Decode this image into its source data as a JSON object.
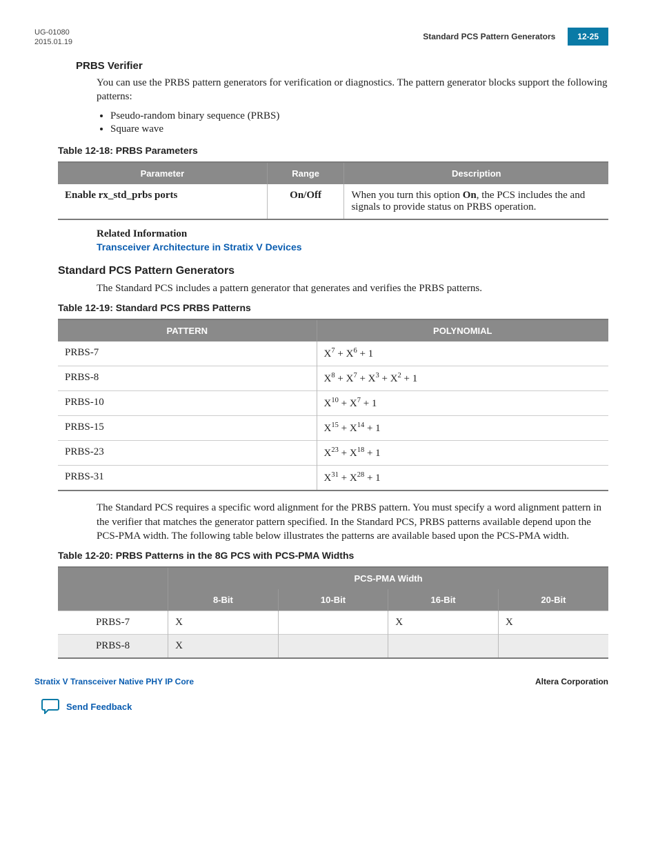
{
  "header": {
    "doc_id": "UG-01080",
    "date": "2015.01.19",
    "running_title": "Standard PCS Pattern Generators",
    "page_number": "12-25"
  },
  "prbs_verifier": {
    "heading": "PRBS Verifier",
    "intro": "You can use the PRBS pattern generators for verification or diagnostics. The pattern generator blocks support the following patterns:",
    "bullets": [
      "Pseudo-random binary sequence (PRBS)",
      "Square wave"
    ]
  },
  "table18": {
    "caption": "Table 12-18: PRBS Parameters",
    "headers": [
      "Parameter",
      "Range",
      "Description"
    ],
    "row": {
      "param": "Enable rx_std_prbs ports",
      "range": "On/Off",
      "desc_pre": "When you turn this option ",
      "desc_on": "On",
      "desc_mid": ", the PCS includes the ",
      "desc_and": " and ",
      "desc_post": " signals to provide status on PRBS operation."
    }
  },
  "related": {
    "label": "Related Information",
    "link": "Transceiver Architecture in Stratix V Devices"
  },
  "section": {
    "heading": "Standard PCS Pattern Generators",
    "intro": "The Standard PCS includes a pattern generator that generates and verifies the PRBS patterns."
  },
  "table19": {
    "caption": "Table 12-19: Standard PCS PRBS Patterns",
    "headers": [
      "PATTERN",
      "POLYNOMIAL"
    ]
  },
  "chart_data": {
    "type": "table",
    "title": "Standard PCS PRBS Patterns",
    "rows": [
      {
        "pattern": "PRBS-7",
        "polynomial": "X^7 + X^6 + 1"
      },
      {
        "pattern": "PRBS-8",
        "polynomial": "X^8 + X^7 + X^3 + X^2 + 1"
      },
      {
        "pattern": "PRBS-10",
        "polynomial": "X^10 + X^7 + 1"
      },
      {
        "pattern": "PRBS-15",
        "polynomial": "X^15 + X^14 + 1"
      },
      {
        "pattern": "PRBS-23",
        "polynomial": "X^23 + X^18 + 1"
      },
      {
        "pattern": "PRBS-31",
        "polynomial": "X^31 + X^28 + 1"
      }
    ]
  },
  "after_table19": "The Standard PCS requires a specific word alignment for the PRBS pattern. You must specify a word alignment pattern in the verifier that matches the generator pattern specified. In the Standard PCS, PRBS patterns available depend upon the PCS-PMA width. The following table below illustrates the patterns are available based upon the PCS-PMA width.",
  "table20": {
    "caption": "Table 12-20: PRBS Patterns in the 8G PCS with PCS-PMA Widths",
    "group_header": "PCS-PMA Width",
    "cols": [
      "8-Bit",
      "10-Bit",
      "16-Bit",
      "20-Bit"
    ],
    "rows": [
      {
        "name": "PRBS-7",
        "cells": [
          "X",
          "",
          "X",
          "X"
        ]
      },
      {
        "name": "PRBS-8",
        "cells": [
          "X",
          "",
          "",
          ""
        ]
      }
    ]
  },
  "footer": {
    "left": "Stratix V Transceiver Native PHY IP Core",
    "right": "Altera Corporation",
    "feedback": "Send Feedback"
  }
}
